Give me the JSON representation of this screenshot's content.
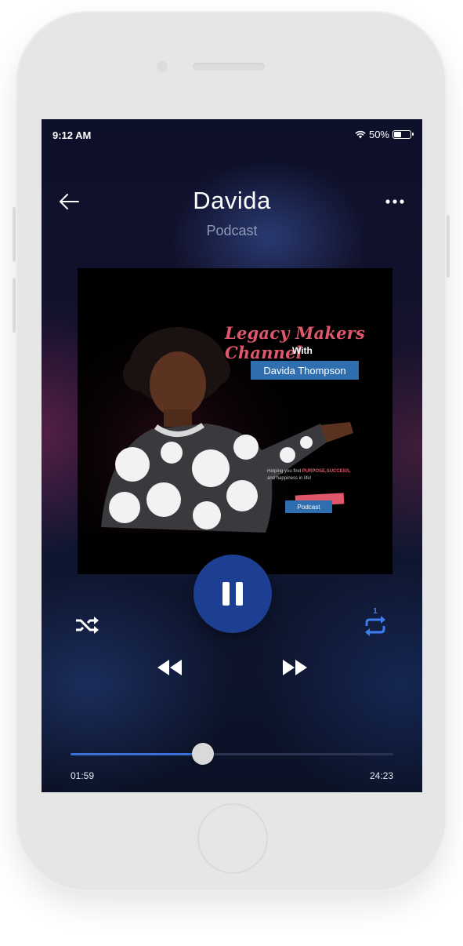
{
  "status_bar": {
    "time": "9:12 AM",
    "battery": "50%",
    "battery_level": 0.5
  },
  "header": {
    "title": "Davida",
    "subtitle": "Podcast"
  },
  "artwork": {
    "script_title": "Legacy Makers Channel",
    "with_text": "With",
    "name_box": "Davida Thompson",
    "tagline_prefix": "Helping you find ",
    "tagline_highlight": "PURPOSE,SUCCESS,",
    "tagline_suffix": "and happiness in life!",
    "badge": "Podcast"
  },
  "player": {
    "state": "playing",
    "repeat_count": "1",
    "elapsed": "01:59",
    "total": "24:23",
    "progress": 0.41
  },
  "colors": {
    "accent": "#1d3f92",
    "progress": "#3d6fd6",
    "script_pink": "#e0566a",
    "name_blue": "#2f6fb0"
  },
  "icons": [
    "back-arrow-icon",
    "more-dots-icon",
    "wifi-icon",
    "battery-icon",
    "pause-icon",
    "shuffle-icon",
    "repeat-one-icon",
    "rewind-icon",
    "fast-forward-icon"
  ]
}
